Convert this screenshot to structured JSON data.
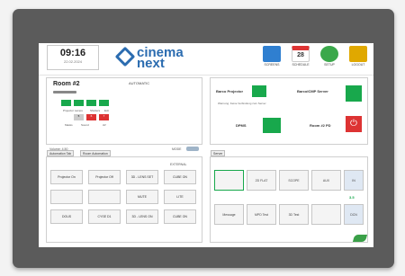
{
  "header": {
    "time": "09:16",
    "date": "22.02.2024",
    "logo_line1": "cinema",
    "logo_line2": "next",
    "icons": [
      {
        "name": "monitor-icon",
        "label": "SCREENS",
        "color": "#2f7fd0"
      },
      {
        "name": "calendar-icon",
        "label": "SCHEDULE",
        "day": "28",
        "color": "#d33"
      },
      {
        "name": "gear-icon",
        "label": "SETUP",
        "color": "#3aa84a"
      },
      {
        "name": "lock-icon",
        "label": "LOGOUT",
        "color": "#e0a800"
      }
    ]
  },
  "room": {
    "title": "Room #2",
    "status": "AUTOMATIC",
    "labels": {
      "projector_lamps": "Projector Lamps",
      "shutters": "Shutters",
      "exit": "Exit",
      "masks": "Masks",
      "sound": "Sound",
      "av": "AV"
    },
    "red_values": [
      "5",
      "6",
      "7"
    ],
    "volume_label": "Volume: 4.50",
    "mode_label": "MODE"
  },
  "projector": {
    "label": "Barco Projector",
    "server_label": "BarcoICMP Server",
    "info": "Warnung: Keine Verbindung zum Server",
    "dpms_label": "DPMS",
    "room_power_label": "Room #2 PD"
  },
  "automation": {
    "tabs": [
      "Automation Tab",
      "Room Automation"
    ],
    "status": "EXTERNAL",
    "buttons": [
      [
        "Projector On",
        "Projector Off",
        "3D - LENS SET",
        "CUBE ON"
      ],
      [
        "",
        "",
        "MUTE",
        "LITE"
      ],
      [
        "DOUS",
        "CYSE D1",
        "3D - LENS ON",
        "CUBE ON"
      ]
    ]
  },
  "rack": {
    "tab": "Server",
    "row1": [
      "",
      "2D FLAT",
      "SCOPE",
      "AUX",
      "IN"
    ],
    "row2": [
      "Message",
      "MPD Test",
      "3D Test",
      "",
      "DCN"
    ],
    "level": "3.5"
  }
}
